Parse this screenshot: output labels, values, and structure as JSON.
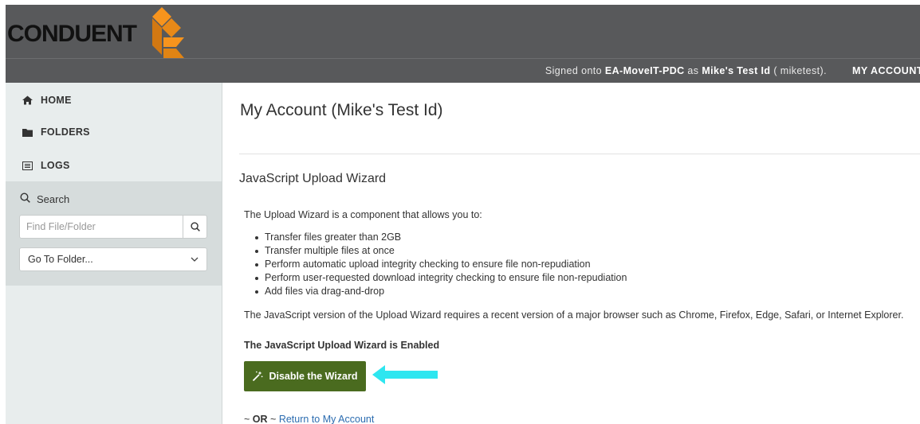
{
  "header": {
    "logo_text": "CONDUENT",
    "signed_prefix": "Signed onto",
    "server": "EA-MoveIT-PDC",
    "as_word": "as",
    "user_name": "Mike's Test Id",
    "username_suffix": "( miketest).",
    "my_account_label": "MY ACCOUNT"
  },
  "sidebar": {
    "nav": [
      {
        "label": "HOME",
        "icon": "home-icon"
      },
      {
        "label": "FOLDERS",
        "icon": "folder-icon"
      },
      {
        "label": "LOGS",
        "icon": "logs-icon"
      }
    ],
    "search": {
      "title": "Search",
      "placeholder": "Find File/Folder",
      "goto_label": "Go To Folder..."
    }
  },
  "main": {
    "page_title": "My Account (Mike's Test Id)",
    "section_title": "JavaScript Upload Wizard",
    "intro": "The Upload Wizard is a component that allows you to:",
    "features": [
      "Transfer files greater than 2GB",
      "Transfer multiple files at once",
      "Perform automatic upload integrity checking to ensure file non-repudiation",
      "Perform user-requested download integrity checking to ensure file non-repudiation",
      "Add files via drag-and-drop"
    ],
    "requirement": "The JavaScript version of the Upload Wizard requires a recent version of a major browser such as Chrome, Firefox, Edge, Safari, or Internet Explorer.",
    "status": "The JavaScript Upload Wizard is Enabled",
    "button_label": "Disable the Wizard",
    "or_prefix": "~",
    "or_word": "OR",
    "or_suffix": "~",
    "return_link": "Return to My Account"
  },
  "colors": {
    "header_bg": "#58595b",
    "logo_orange": "#f7941d",
    "sidebar_bg": "#e8eded",
    "search_panel_bg": "#d6dcdc",
    "button_bg": "#4a6b1f",
    "arrow": "#2ee6f0",
    "link": "#2b6cb0"
  }
}
